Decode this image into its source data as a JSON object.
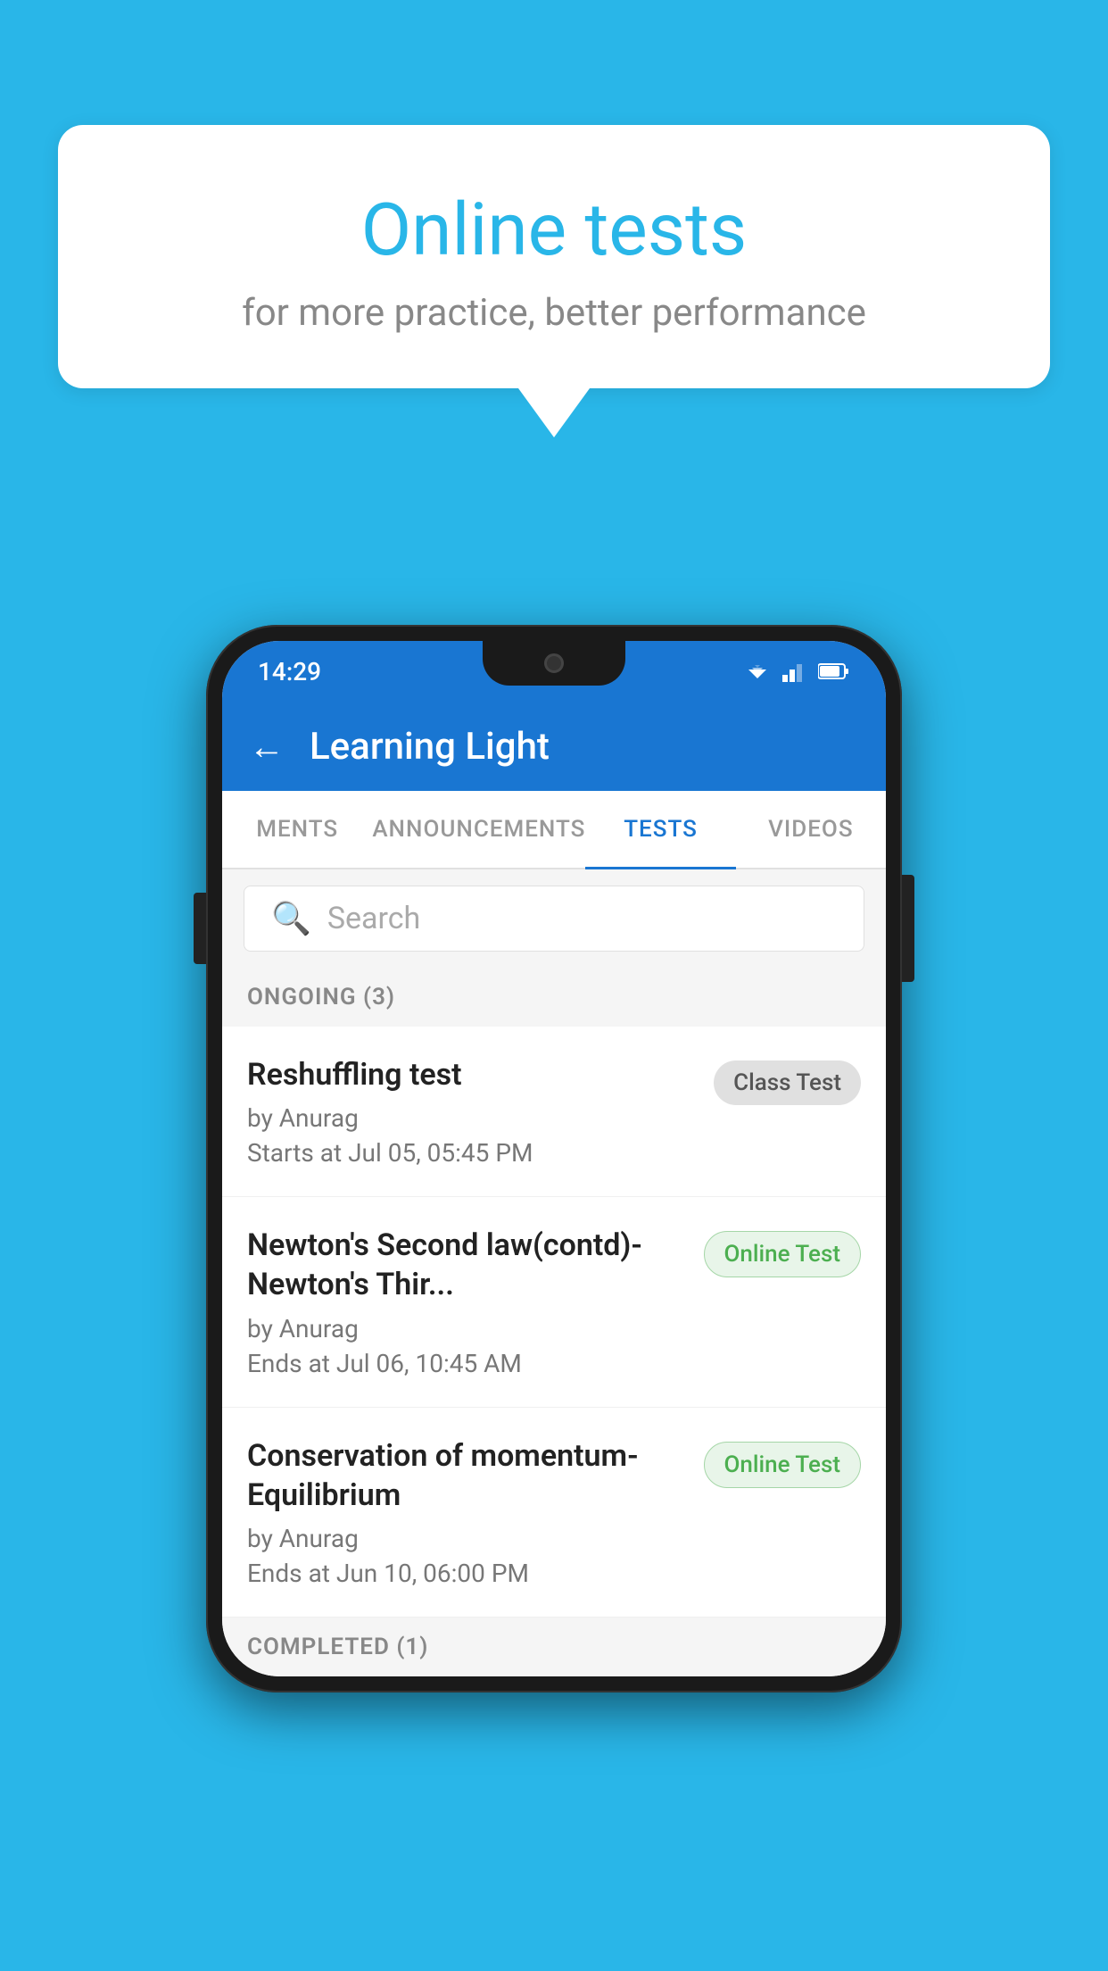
{
  "background_color": "#29b6e8",
  "speech_bubble": {
    "title": "Online tests",
    "subtitle": "for more practice, better performance"
  },
  "phone": {
    "status_bar": {
      "time": "14:29"
    },
    "app_bar": {
      "back_label": "←",
      "title": "Learning Light"
    },
    "tabs": [
      {
        "label": "MENTS",
        "active": false
      },
      {
        "label": "ANNOUNCEMENTS",
        "active": false
      },
      {
        "label": "TESTS",
        "active": true
      },
      {
        "label": "VIDEOS",
        "active": false
      }
    ],
    "search": {
      "placeholder": "Search"
    },
    "sections": [
      {
        "title": "ONGOING (3)",
        "items": [
          {
            "name": "Reshuffling test",
            "author": "by Anurag",
            "time_label": "Starts at",
            "time": "Jul 05, 05:45 PM",
            "badge": "Class Test",
            "badge_type": "class"
          },
          {
            "name": "Newton's Second law(contd)-Newton's Thir...",
            "author": "by Anurag",
            "time_label": "Ends at",
            "time": "Jul 06, 10:45 AM",
            "badge": "Online Test",
            "badge_type": "online"
          },
          {
            "name": "Conservation of momentum-Equilibrium",
            "author": "by Anurag",
            "time_label": "Ends at",
            "time": "Jun 10, 06:00 PM",
            "badge": "Online Test",
            "badge_type": "online"
          }
        ]
      }
    ],
    "completed_section": {
      "title": "COMPLETED (1)"
    }
  }
}
